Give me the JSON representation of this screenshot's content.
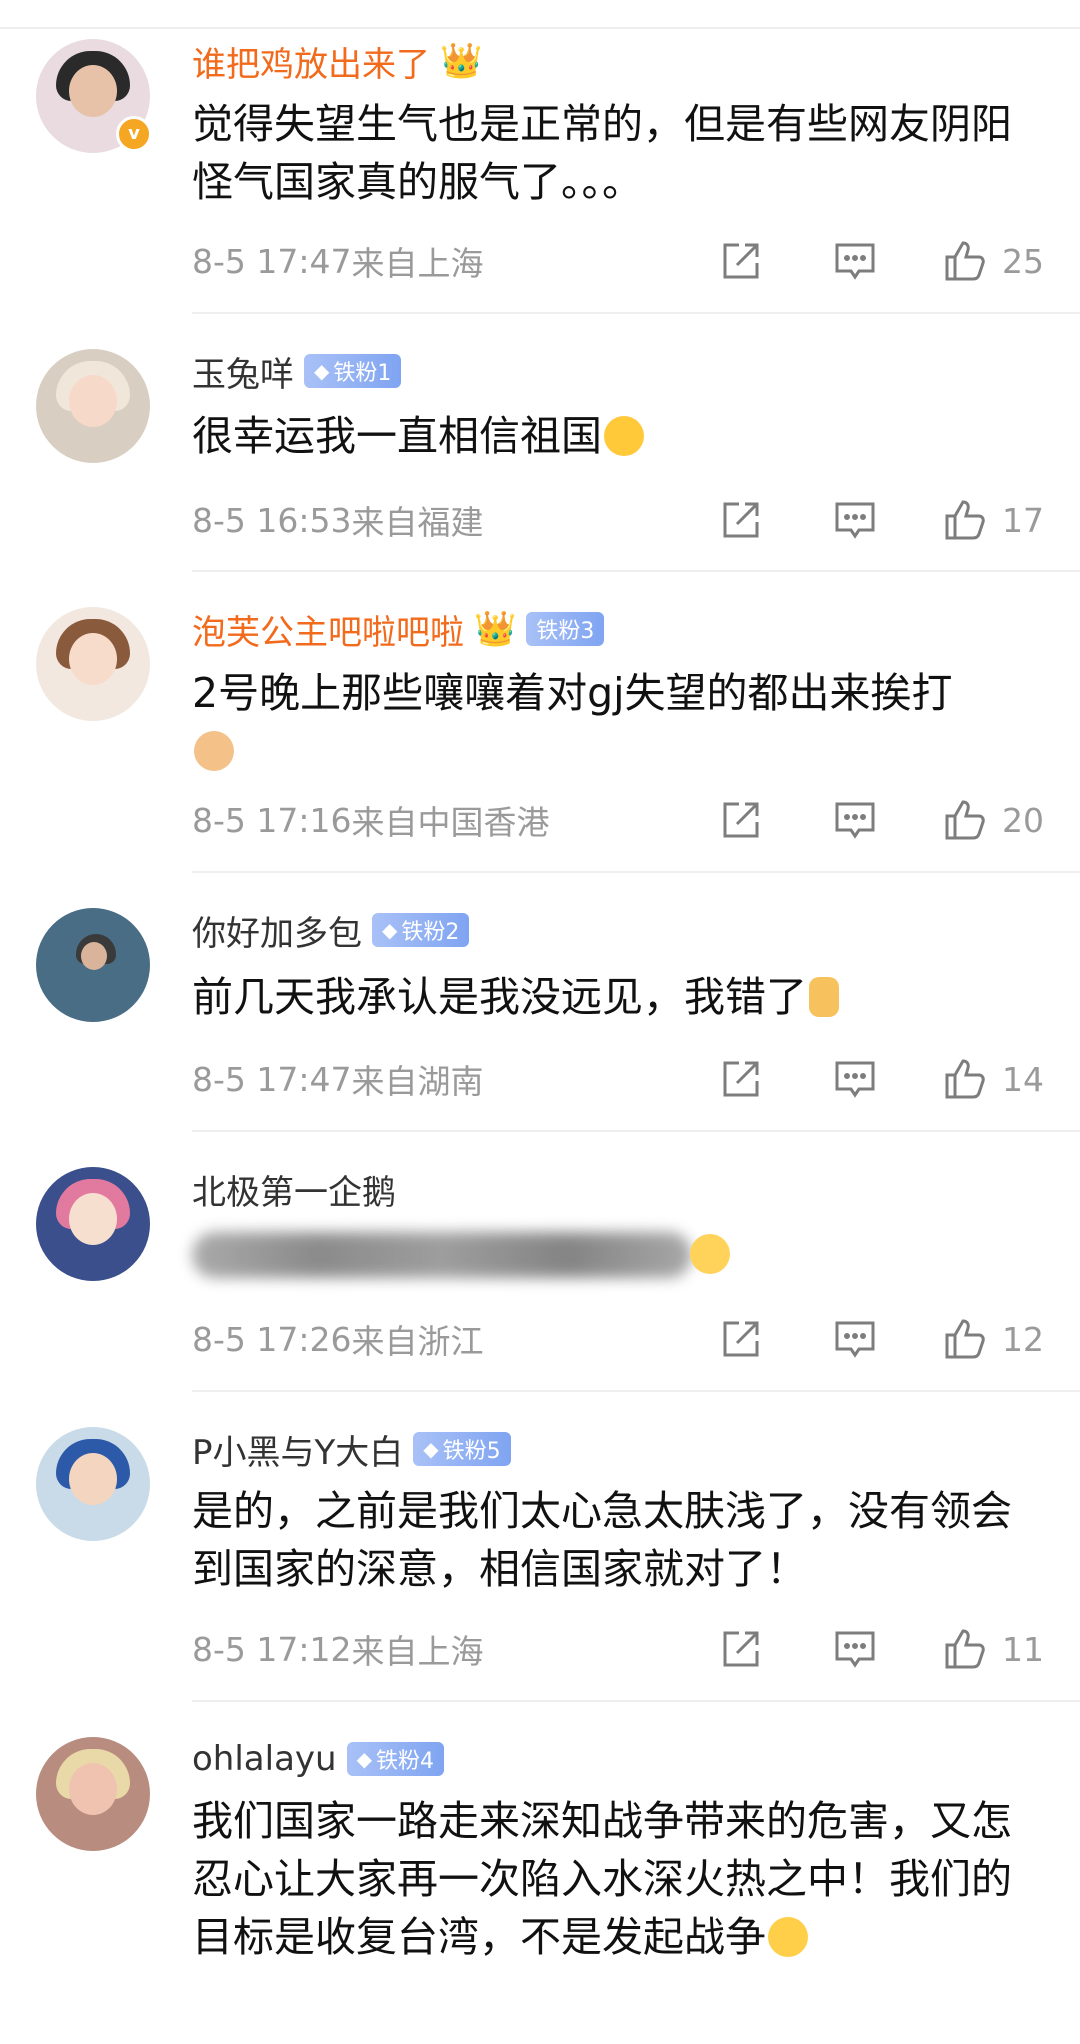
{
  "comments": [
    {
      "username": "谁把鸡放出来了",
      "name_style": "vip",
      "crown": "👑",
      "fan_badge": "",
      "verified": "v",
      "text": "觉得失望生气也是正常的，但是有些网友阴阳怪气国家真的服气了。。。",
      "emoji": "",
      "time": "8-5 17:47",
      "location": "来自上海",
      "likes": "25"
    },
    {
      "username": "玉兔咩",
      "name_style": "normal",
      "crown": "",
      "fan_badge": "铁粉1",
      "verified": "",
      "text": "很幸运我一直相信祖国",
      "emoji": "laughing-emoji",
      "time": "8-5 16:53",
      "location": "来自福建",
      "likes": "17"
    },
    {
      "username": "泡芙公主吧啦吧啦",
      "name_style": "vip",
      "crown": "👑",
      "fan_badge": "铁粉3",
      "verified": "",
      "text": "2号晚上那些嚷嚷着对gj失望的都出来挨打",
      "emoji": "cat-emoji",
      "time": "8-5 17:16",
      "location": "来自中国香港",
      "likes": "20"
    },
    {
      "username": "你好加多包",
      "name_style": "normal",
      "crown": "",
      "fan_badge": "铁粉2",
      "verified": "",
      "text": "前几天我承认是我没远见，我错了",
      "emoji": "thumbs-up-emoji",
      "time": "8-5 17:47",
      "location": "来自湖南",
      "likes": "14"
    },
    {
      "username": "北极第一企鹅",
      "name_style": "normal",
      "crown": "",
      "fan_badge": "",
      "verified": "",
      "text": "",
      "emoji": "grin-emoji",
      "time": "8-5 17:26",
      "location": "来自浙江",
      "likes": "12"
    },
    {
      "username": "P小黑与Y大白",
      "name_style": "normal",
      "crown": "",
      "fan_badge": "铁粉5",
      "verified": "",
      "text": "是的，之前是我们太心急太肤浅了，没有领会到国家的深意，相信国家就对了！",
      "emoji": "",
      "time": "8-5 17:12",
      "location": "来自上海",
      "likes": "11"
    },
    {
      "username": "ohlalayu",
      "name_style": "normal",
      "crown": "",
      "fan_badge": "铁粉4",
      "verified": "",
      "text": "我们国家一路走来深知战争带来的危害，又怎忍心让大家再一次陷入水深火热之中！我们的目标是收复台湾，不是发起战争",
      "emoji": "crying-laughing-emoji",
      "time": "",
      "location": "",
      "likes": ""
    }
  ],
  "icons": {
    "repost": "share-icon",
    "comment": "comment-icon",
    "like": "thumbs-up-icon",
    "fan_badge": "diamond-icon"
  },
  "colors": {
    "vip_name": "#f26a1b",
    "normal_name": "#333333",
    "meta": "#9a9a9a",
    "badge": "#8aabf3"
  }
}
